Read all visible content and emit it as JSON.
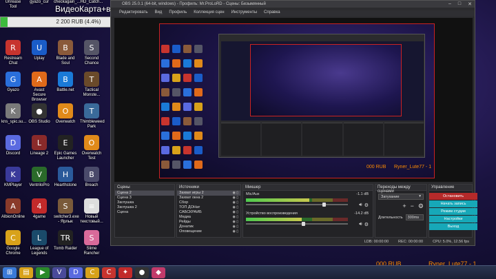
{
  "overlay": {
    "title": "ВидеоКарта+веб",
    "amount": "2 200 RUB (4.4%)",
    "progress": 0.044
  },
  "obs": {
    "window_title": "OBS 25.0.1 (64-bit, windows) - Профиль: Mr.ProLoRD - Сцены: Безымянный",
    "menu": [
      "Редактировать",
      "Вид",
      "Профиль",
      "Коллекция сцен",
      "Инструменты",
      "Справка"
    ],
    "preview_amount": "000 RUB",
    "preview_user": "Ryner_Lute77 - 1",
    "docks": {
      "scenes": {
        "title": "Сцены",
        "items": [
          "Сцена 2",
          "Сцена 3",
          "Заглушка",
          "Заглушка 2",
          "Сцена"
        ],
        "selected": 0
      },
      "sources": {
        "title": "Источники",
        "items": [
          "Захват игры 2",
          "Захват окна 2",
          "Сбор",
          "ТОП ДОНат",
          "САБСКРАЙБ",
          "Медиа",
          "Рейды",
          "Донатик",
          "Оповещение"
        ],
        "selected": 0
      },
      "mixer": {
        "title": "Микшер",
        "tracks": [
          {
            "name": "Mic/Aux",
            "db": "-1.1 dB",
            "level": 0.62,
            "volume": 0.75
          },
          {
            "name": "Устройство воспроизведения",
            "db": "-14.2 dB",
            "level": 0.55,
            "volume": 0.55
          }
        ]
      },
      "transitions": {
        "title": "Переходы между сценами",
        "selected": "Затухание",
        "duration_label": "Длительность",
        "duration_value": "300ms"
      },
      "controls": {
        "title": "Управление",
        "buttons": [
          "Остановить",
          "Начать запись",
          "Режим студии",
          "Настройки",
          "Выход"
        ]
      }
    },
    "status": {
      "ldb": "LDB: 00:00:00",
      "rec": "REC: 00:00:00",
      "cpu": "CPU: 5.0%, 12.56 fps"
    }
  },
  "bottom_stats": {
    "amount": "000 RUB",
    "user": "Ryner_Lute77 - 1"
  },
  "desktop_icons": [
    {
      "label": "Restream Chat",
      "color": "#c7342e",
      "glyph": "R"
    },
    {
      "label": "Uplay",
      "color": "#1a5cc8",
      "glyph": "U"
    },
    {
      "label": "Blade and Soul",
      "color": "#8a5a3a",
      "glyph": "B"
    },
    {
      "label": "Second Chance",
      "color": "#555566",
      "glyph": "S"
    },
    {
      "label": "Gyazo",
      "color": "#2a6fdb",
      "glyph": "G"
    },
    {
      "label": "Avast Secure Browser",
      "color": "#e06a1a",
      "glyph": "A"
    },
    {
      "label": "Battle.net",
      "color": "#1a7ad8",
      "glyph": "B"
    },
    {
      "label": "Tactical Monste...",
      "color": "#6a4a2a",
      "glyph": "T"
    },
    {
      "label": "kns_spic.su...",
      "color": "#7a7a7a",
      "glyph": "K"
    },
    {
      "label": "OBS Studio",
      "color": "#333333",
      "glyph": "●"
    },
    {
      "label": "Overwatch",
      "color": "#e08a1a",
      "glyph": "O"
    },
    {
      "label": "Thimbleweed Park",
      "color": "#3a6a9a",
      "glyph": "T"
    },
    {
      "label": "Discord",
      "color": "#5a6ae0",
      "glyph": "D"
    },
    {
      "label": "Lineage 2",
      "color": "#8a2a2a",
      "glyph": "L"
    },
    {
      "label": "Epic Games Launcher",
      "color": "#222222",
      "glyph": "E"
    },
    {
      "label": "Overwatch Test",
      "color": "#e08a1a",
      "glyph": "O"
    },
    {
      "label": "KMPlayer",
      "color": "#3a3a9a",
      "glyph": "K"
    },
    {
      "label": "VentriloPro",
      "color": "#2a6a2a",
      "glyph": "V"
    },
    {
      "label": "Hearthstone",
      "color": "#2a5a9a",
      "glyph": "H"
    },
    {
      "label": "Breach",
      "color": "#4a4a6a",
      "glyph": "B"
    },
    {
      "label": "AlbionOnline",
      "color": "#8a3a2a",
      "glyph": "A"
    },
    {
      "label": "4game",
      "color": "#c22a2a",
      "glyph": "4"
    },
    {
      "label": "switcher3.exe - Ярлык",
      "color": "#7a5a3a",
      "glyph": "S"
    },
    {
      "label": "Новый текстовый...",
      "color": "#dddddd",
      "glyph": "≡"
    },
    {
      "label": "Google Chrome",
      "color": "#d8a21a",
      "glyph": "C"
    },
    {
      "label": "League of Legends",
      "color": "#1a4a6a",
      "glyph": "L"
    },
    {
      "label": "Tomb Raider",
      "color": "#222222",
      "glyph": "TR"
    },
    {
      "label": "Slime Rancher",
      "color": "#d86a9a",
      "glyph": "S"
    }
  ],
  "top_icons": [
    "Unrease Tool",
    "gyazo_cur",
    "checkagain_...",
    "HD_Catch..."
  ],
  "taskbar_icons": [
    {
      "name": "start-button",
      "glyph": "⊞",
      "color": "#3a7ad8"
    },
    {
      "name": "explorer",
      "glyph": "▤",
      "color": "#d8a21a"
    },
    {
      "name": "media",
      "glyph": "▶",
      "color": "#2a8a2a"
    },
    {
      "name": "app-v",
      "glyph": "V",
      "color": "#4a4a9a"
    },
    {
      "name": "discord",
      "glyph": "D",
      "color": "#5a6ae0"
    },
    {
      "name": "chrome",
      "glyph": "C",
      "color": "#d8a21a"
    },
    {
      "name": "chrome-2",
      "glyph": "C",
      "color": "#c7342e"
    },
    {
      "name": "app-red",
      "glyph": "✦",
      "color": "#c22a2a"
    },
    {
      "name": "obs",
      "glyph": "●",
      "color": "#333333"
    },
    {
      "name": "app-pink",
      "glyph": "◆",
      "color": "#c23a6a"
    }
  ]
}
